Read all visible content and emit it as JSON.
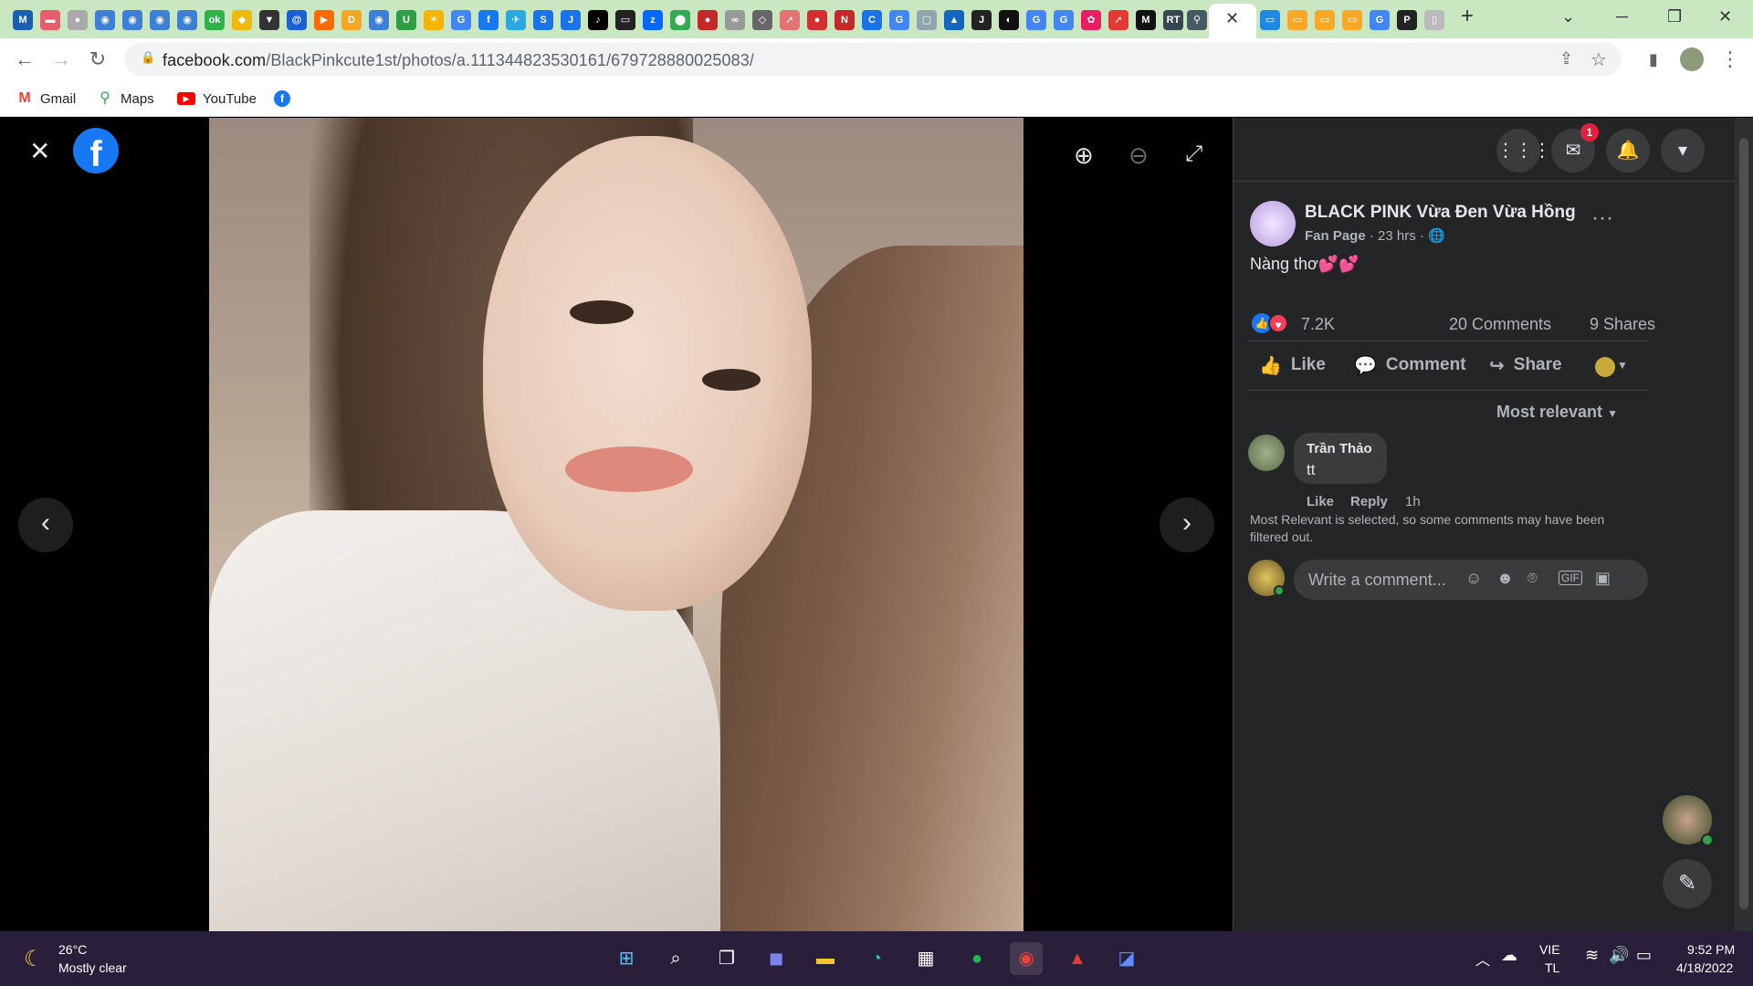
{
  "browser": {
    "url_host": "facebook.com",
    "url_path": "/BlackPinkcute1st/photos/a.111344823530161/679728880025083/",
    "bookmarks": [
      {
        "label": "Gmail",
        "icon": "gmail-icon",
        "color": "#ea4335"
      },
      {
        "label": "Maps",
        "icon": "maps-pin-icon",
        "color": "#34a853"
      },
      {
        "label": "YouTube",
        "icon": "youtube-icon",
        "color": "#ff0000"
      },
      {
        "label": "",
        "icon": "facebook-icon",
        "color": "#1877f2"
      }
    ],
    "tab_close": "✕",
    "new_tab": "+"
  },
  "viewer": {
    "close_icon": "✕",
    "prev_icon": "‹",
    "next_icon": "›"
  },
  "post": {
    "page_name": "BLACK PINK Vừa Đen Vừa Hồng",
    "page_type": "Fan Page",
    "time": "23 hrs",
    "caption": "Nàng thơ💕💕",
    "reactions_count": "7.2K",
    "comments_count": "20 Comments",
    "shares_count": "9 Shares",
    "like_label": "Like",
    "comment_label": "Comment",
    "share_label": "Share",
    "sort_label": "Most relevant",
    "notifications_badge": "1"
  },
  "comments": [
    {
      "author": "Trần Thảo",
      "text": "tt",
      "like": "Like",
      "reply": "Reply",
      "time": "1h"
    }
  ],
  "filter_note": "Most Relevant is selected, so some comments may have been filtered out.",
  "composer_placeholder": "Write a comment...",
  "taskbar": {
    "temp": "26°C",
    "weather": "Mostly clear",
    "lang1": "VIE",
    "lang2": "TL",
    "time": "9:52 PM",
    "date": "4/18/2022"
  },
  "colors": {
    "fb_blue": "#1877f2",
    "panel_bg": "#242526",
    "tab_strip": "#c9e8c1"
  }
}
